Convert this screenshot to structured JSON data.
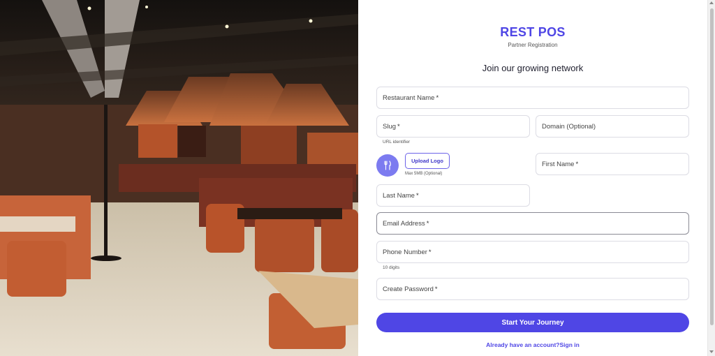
{
  "hero": {
    "image": "restaurant-interior-photo"
  },
  "brand": {
    "name": "REST POS",
    "subtitle": "Partner Registration"
  },
  "form": {
    "headline": "Join our growing network",
    "restaurant_name": {
      "label": "Restaurant Name",
      "required": "*"
    },
    "slug": {
      "label": "Slug",
      "required": "*",
      "helper": "URL identifier"
    },
    "domain": {
      "label": "Domain (Optional)"
    },
    "logo": {
      "icon": "fork-knife-icon",
      "button_label": "Upload Logo",
      "helper": "Max 5MB (Optional)"
    },
    "first_name": {
      "label": "First Name",
      "required": "*"
    },
    "last_name": {
      "label": "Last Name",
      "required": "*"
    },
    "email": {
      "label": "Email Address",
      "required": "*"
    },
    "phone": {
      "label": "Phone Number",
      "required": "*",
      "helper": "10 digits"
    },
    "password": {
      "label": "Create Password",
      "required": "*"
    },
    "submit_label": "Start Your Journey",
    "signin_prompt": "Already have an account?",
    "signin_link": "Sign in"
  },
  "colors": {
    "accent": "#4f46e5",
    "avatar": "#7c7bf0"
  }
}
